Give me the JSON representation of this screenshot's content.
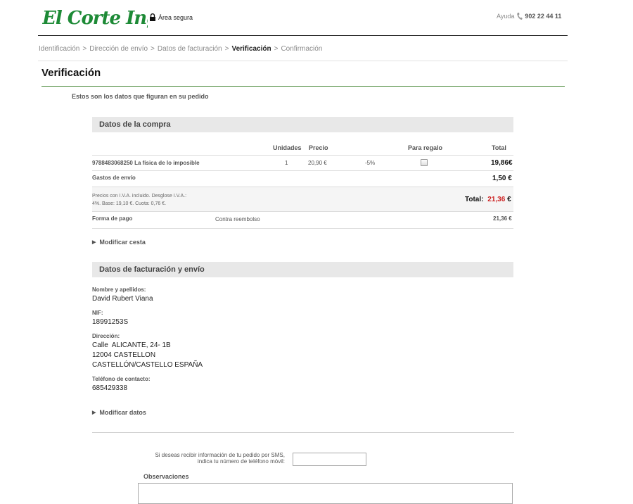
{
  "brand": {
    "name": "El Corte Inglés",
    "color": "#1d8a36"
  },
  "header": {
    "secure_label": "Área segura",
    "help_label": "Ayuda",
    "phone": "902 22 44 11"
  },
  "breadcrumb": {
    "steps": [
      "Identificación",
      "Dirección de envío",
      "Datos de facturación",
      "Verificación",
      "Confirmación"
    ],
    "separator": ">"
  },
  "page": {
    "title": "Verificación",
    "intro": "Estos son los datos que figuran en su pedido"
  },
  "purchase": {
    "section_title": "Datos de la compra",
    "columns": {
      "units": "Unidades",
      "price": "Precio",
      "gift": "Para regalo",
      "total": "Total"
    },
    "item": {
      "name": "9788483068250 La física de lo imposible",
      "units": "1",
      "price": "20,90 €",
      "discount": "-5%",
      "gift_checked": false,
      "total": "19,86€"
    },
    "shipping": {
      "label": "Gastos de envío",
      "value": "1,50 €"
    },
    "tax_note_line1": "Precios con I.V.A. incluido. Desglose I.V.A.:",
    "tax_note_line2": "4%. Base: 19,10 €. Cuota: 0,76 €.",
    "total_label": "Total:",
    "total_value": "21,36",
    "total_currency": "€",
    "payment": {
      "label": "Forma de pago",
      "method": "Contra reembolso",
      "amount": "21,36 €"
    },
    "modify_link": "Modificar cesta"
  },
  "billing": {
    "section_title": "Datos de facturación y envío",
    "name_label": "Nombre y apellidos:",
    "name": "David Rubert Viana",
    "nif_label": "NIF:",
    "nif": "18991253S",
    "address_label": "Dirección:",
    "address_line1": "Calle  ALICANTE, 24- 1B",
    "address_line2": "12004 CASTELLON",
    "address_line3": "CASTELLÓN/CASTELLO ESPAÑA",
    "phone_label": "Teléfono de contacto:",
    "phone": "685429338",
    "modify_link": "Modificar datos"
  },
  "sms": {
    "label_line1": "Si deseas recibir información de tu pedido por SMS,",
    "label_line2": "indica tu número de teléfono móvil:",
    "value": ""
  },
  "observations": {
    "label": "Observaciones",
    "value": ""
  },
  "colors": {
    "accent_red": "#cc1f1f",
    "rule_green": "#4a8a3a"
  }
}
